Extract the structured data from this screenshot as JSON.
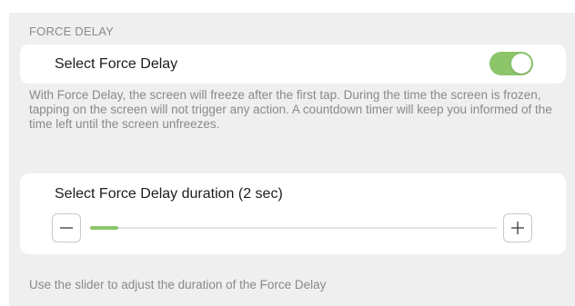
{
  "section": {
    "header": "FORCE DELAY"
  },
  "toggle_row": {
    "label": "Select Force Delay",
    "enabled": true
  },
  "description": "With Force Delay, the screen will freeze after the first tap. During the time the screen is frozen, tapping on the screen will not trigger any action. A countdown timer will keep you informed of the time left until the screen unfreezes.",
  "slider_row": {
    "label": "Select Force Delay duration (2 sec)",
    "value_fraction": 0.07,
    "minus_icon": "minus-icon",
    "plus_icon": "plus-icon"
  },
  "slider_hint": "Use the slider to adjust the duration of the Force Delay",
  "colors": {
    "accent": "#8cc56a",
    "background": "#efeff0",
    "secondary_text": "#8a8a8e"
  }
}
